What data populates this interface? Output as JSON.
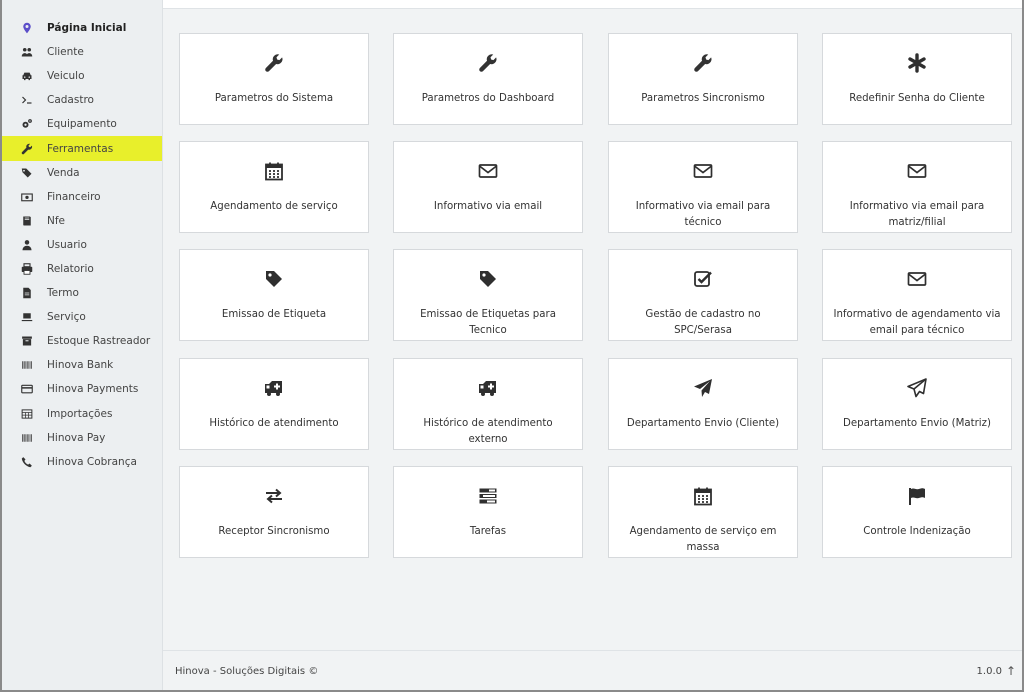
{
  "sidebar": {
    "items": [
      {
        "label": "Página Inicial",
        "icon": "map-marker-icon"
      },
      {
        "label": "Cliente",
        "icon": "users-icon"
      },
      {
        "label": "Veiculo",
        "icon": "car-icon"
      },
      {
        "label": "Cadastro",
        "icon": "terminal-icon"
      },
      {
        "label": "Equipamento",
        "icon": "cogs-icon"
      },
      {
        "label": "Ferramentas",
        "icon": "wrench-icon"
      },
      {
        "label": "Venda",
        "icon": "tags-icon"
      },
      {
        "label": "Financeiro",
        "icon": "money-icon"
      },
      {
        "label": "Nfe",
        "icon": "book-icon"
      },
      {
        "label": "Usuario",
        "icon": "user-icon"
      },
      {
        "label": "Relatorio",
        "icon": "print-icon"
      },
      {
        "label": "Termo",
        "icon": "file-icon"
      },
      {
        "label": "Serviço",
        "icon": "laptop-icon"
      },
      {
        "label": "Estoque Rastreador",
        "icon": "archive-icon"
      },
      {
        "label": "Hinova Bank",
        "icon": "barcode-icon"
      },
      {
        "label": "Hinova Payments",
        "icon": "credit-card-icon"
      },
      {
        "label": "Importações",
        "icon": "table-icon"
      },
      {
        "label": "Hinova Pay",
        "icon": "barcode-icon"
      },
      {
        "label": "Hinova Cobrança",
        "icon": "phone-icon"
      }
    ]
  },
  "cards": [
    {
      "label": "Parametros do Sistema",
      "icon": "wrench-icon"
    },
    {
      "label": "Parametros do Dashboard",
      "icon": "wrench-icon"
    },
    {
      "label": "Parametros Sincronismo",
      "icon": "wrench-icon"
    },
    {
      "label": "Redefinir Senha do Cliente",
      "icon": "asterisk-icon"
    },
    {
      "label": "Agendamento de serviço",
      "icon": "calendar-icon"
    },
    {
      "label": "Informativo via email",
      "icon": "envelope-icon"
    },
    {
      "label": "Informativo via email para técnico",
      "icon": "envelope-icon"
    },
    {
      "label": "Informativo via email para matriz/filial",
      "icon": "envelope-icon"
    },
    {
      "label": "Emissao de Etiqueta",
      "icon": "tag-icon"
    },
    {
      "label": "Emissao de Etiquetas para Tecnico",
      "icon": "tag-icon"
    },
    {
      "label": "Gestão de cadastro no SPC/Serasa",
      "icon": "check-square-icon"
    },
    {
      "label": "Informativo de agendamento via email para técnico",
      "icon": "envelope-icon"
    },
    {
      "label": "Histórico de atendimento",
      "icon": "ambulance-icon"
    },
    {
      "label": "Histórico de atendimento externo",
      "icon": "ambulance-icon"
    },
    {
      "label": "Departamento Envio (Cliente)",
      "icon": "paper-plane-icon"
    },
    {
      "label": "Departamento Envio (Matriz)",
      "icon": "paper-plane-outline-icon"
    },
    {
      "label": "Receptor Sincronismo",
      "icon": "exchange-icon"
    },
    {
      "label": "Tarefas",
      "icon": "tasks-icon"
    },
    {
      "label": "Agendamento de serviço em massa",
      "icon": "calendar-icon"
    },
    {
      "label": "Controle Indenização",
      "icon": "flag-icon"
    }
  ],
  "footer": {
    "company": "Hinova - Soluções Digitais ©",
    "version": "1.0.0"
  },
  "colors": {
    "active_highlight": "#e8ef2b",
    "sidebar_bg": "#eceff1",
    "main_bg": "#f1f3f4",
    "home_icon": "#5b4ec9"
  }
}
